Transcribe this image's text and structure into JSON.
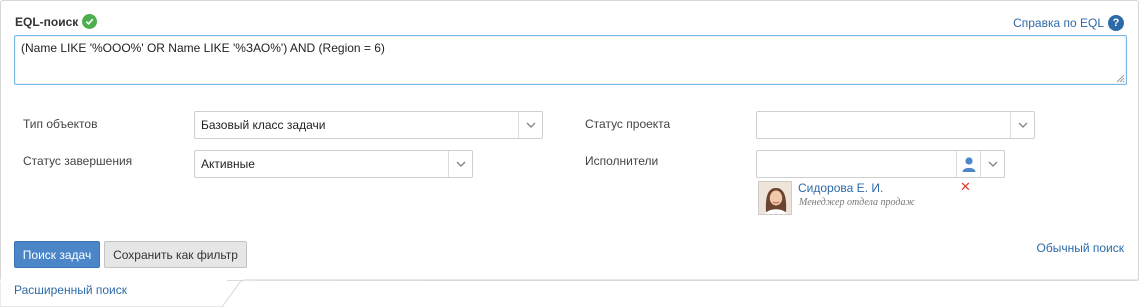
{
  "eql": {
    "title": "EQL-поиск",
    "help_label": "Справка по EQL",
    "query": "(Name LIKE '%ООО%' OR Name LIKE '%ЗАО%') AND (Region = 6)"
  },
  "filters": {
    "object_type": {
      "label": "Тип объектов",
      "value": "Базовый класс задачи"
    },
    "completion_status": {
      "label": "Статус завершения",
      "value": "Активные"
    },
    "project_status": {
      "label": "Статус проекта",
      "value": ""
    },
    "performers": {
      "label": "Исполнители",
      "value": "",
      "selected": [
        {
          "name": "Сидорова Е. И.",
          "role": "Менеджер отдела продаж"
        }
      ]
    }
  },
  "actions": {
    "search_label": "Поиск задач",
    "save_filter_label": "Сохранить как фильтр",
    "simple_search_label": "Обычный поиск"
  },
  "tabs": {
    "advanced_label": "Расширенный поиск"
  },
  "colors": {
    "accent": "#4a86c8",
    "link": "#2d6aa8",
    "success": "#4cae4c",
    "danger": "#e03c31"
  },
  "icons": [
    "check-icon",
    "help-icon",
    "chevron-down-icon",
    "user-icon",
    "close-icon",
    "avatar"
  ]
}
